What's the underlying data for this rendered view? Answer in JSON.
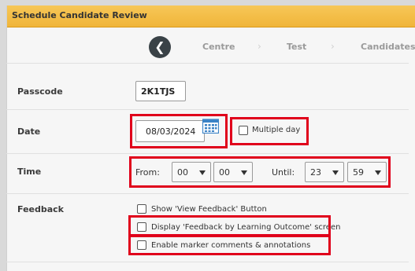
{
  "window": {
    "title": "Schedule Candidate Review"
  },
  "stepper": {
    "steps": [
      "Centre",
      "Test",
      "Candidates"
    ],
    "separator": "›"
  },
  "passcode": {
    "label": "Passcode",
    "value": "2K1TJS"
  },
  "date": {
    "label": "Date",
    "value": "08/03/2024",
    "multiple_day_label": "Multiple day",
    "multiple_day_checked": false
  },
  "time": {
    "label": "Time",
    "from_label": "From:",
    "from_hour": "00",
    "from_minute": "00",
    "until_label": "Until:",
    "until_hour": "23",
    "until_minute": "59"
  },
  "feedback": {
    "label": "Feedback",
    "options": [
      {
        "label": "Show 'View Feedback' Button",
        "checked": false
      },
      {
        "label": "Display 'Feedback by Learning Outcome' screen",
        "checked": false
      },
      {
        "label": "Enable marker comments & annotations",
        "checked": false
      }
    ]
  },
  "colors": {
    "title_bar": "#f0b53a",
    "highlight": "#e0001b",
    "calendar_icon": "#3b83c6"
  }
}
